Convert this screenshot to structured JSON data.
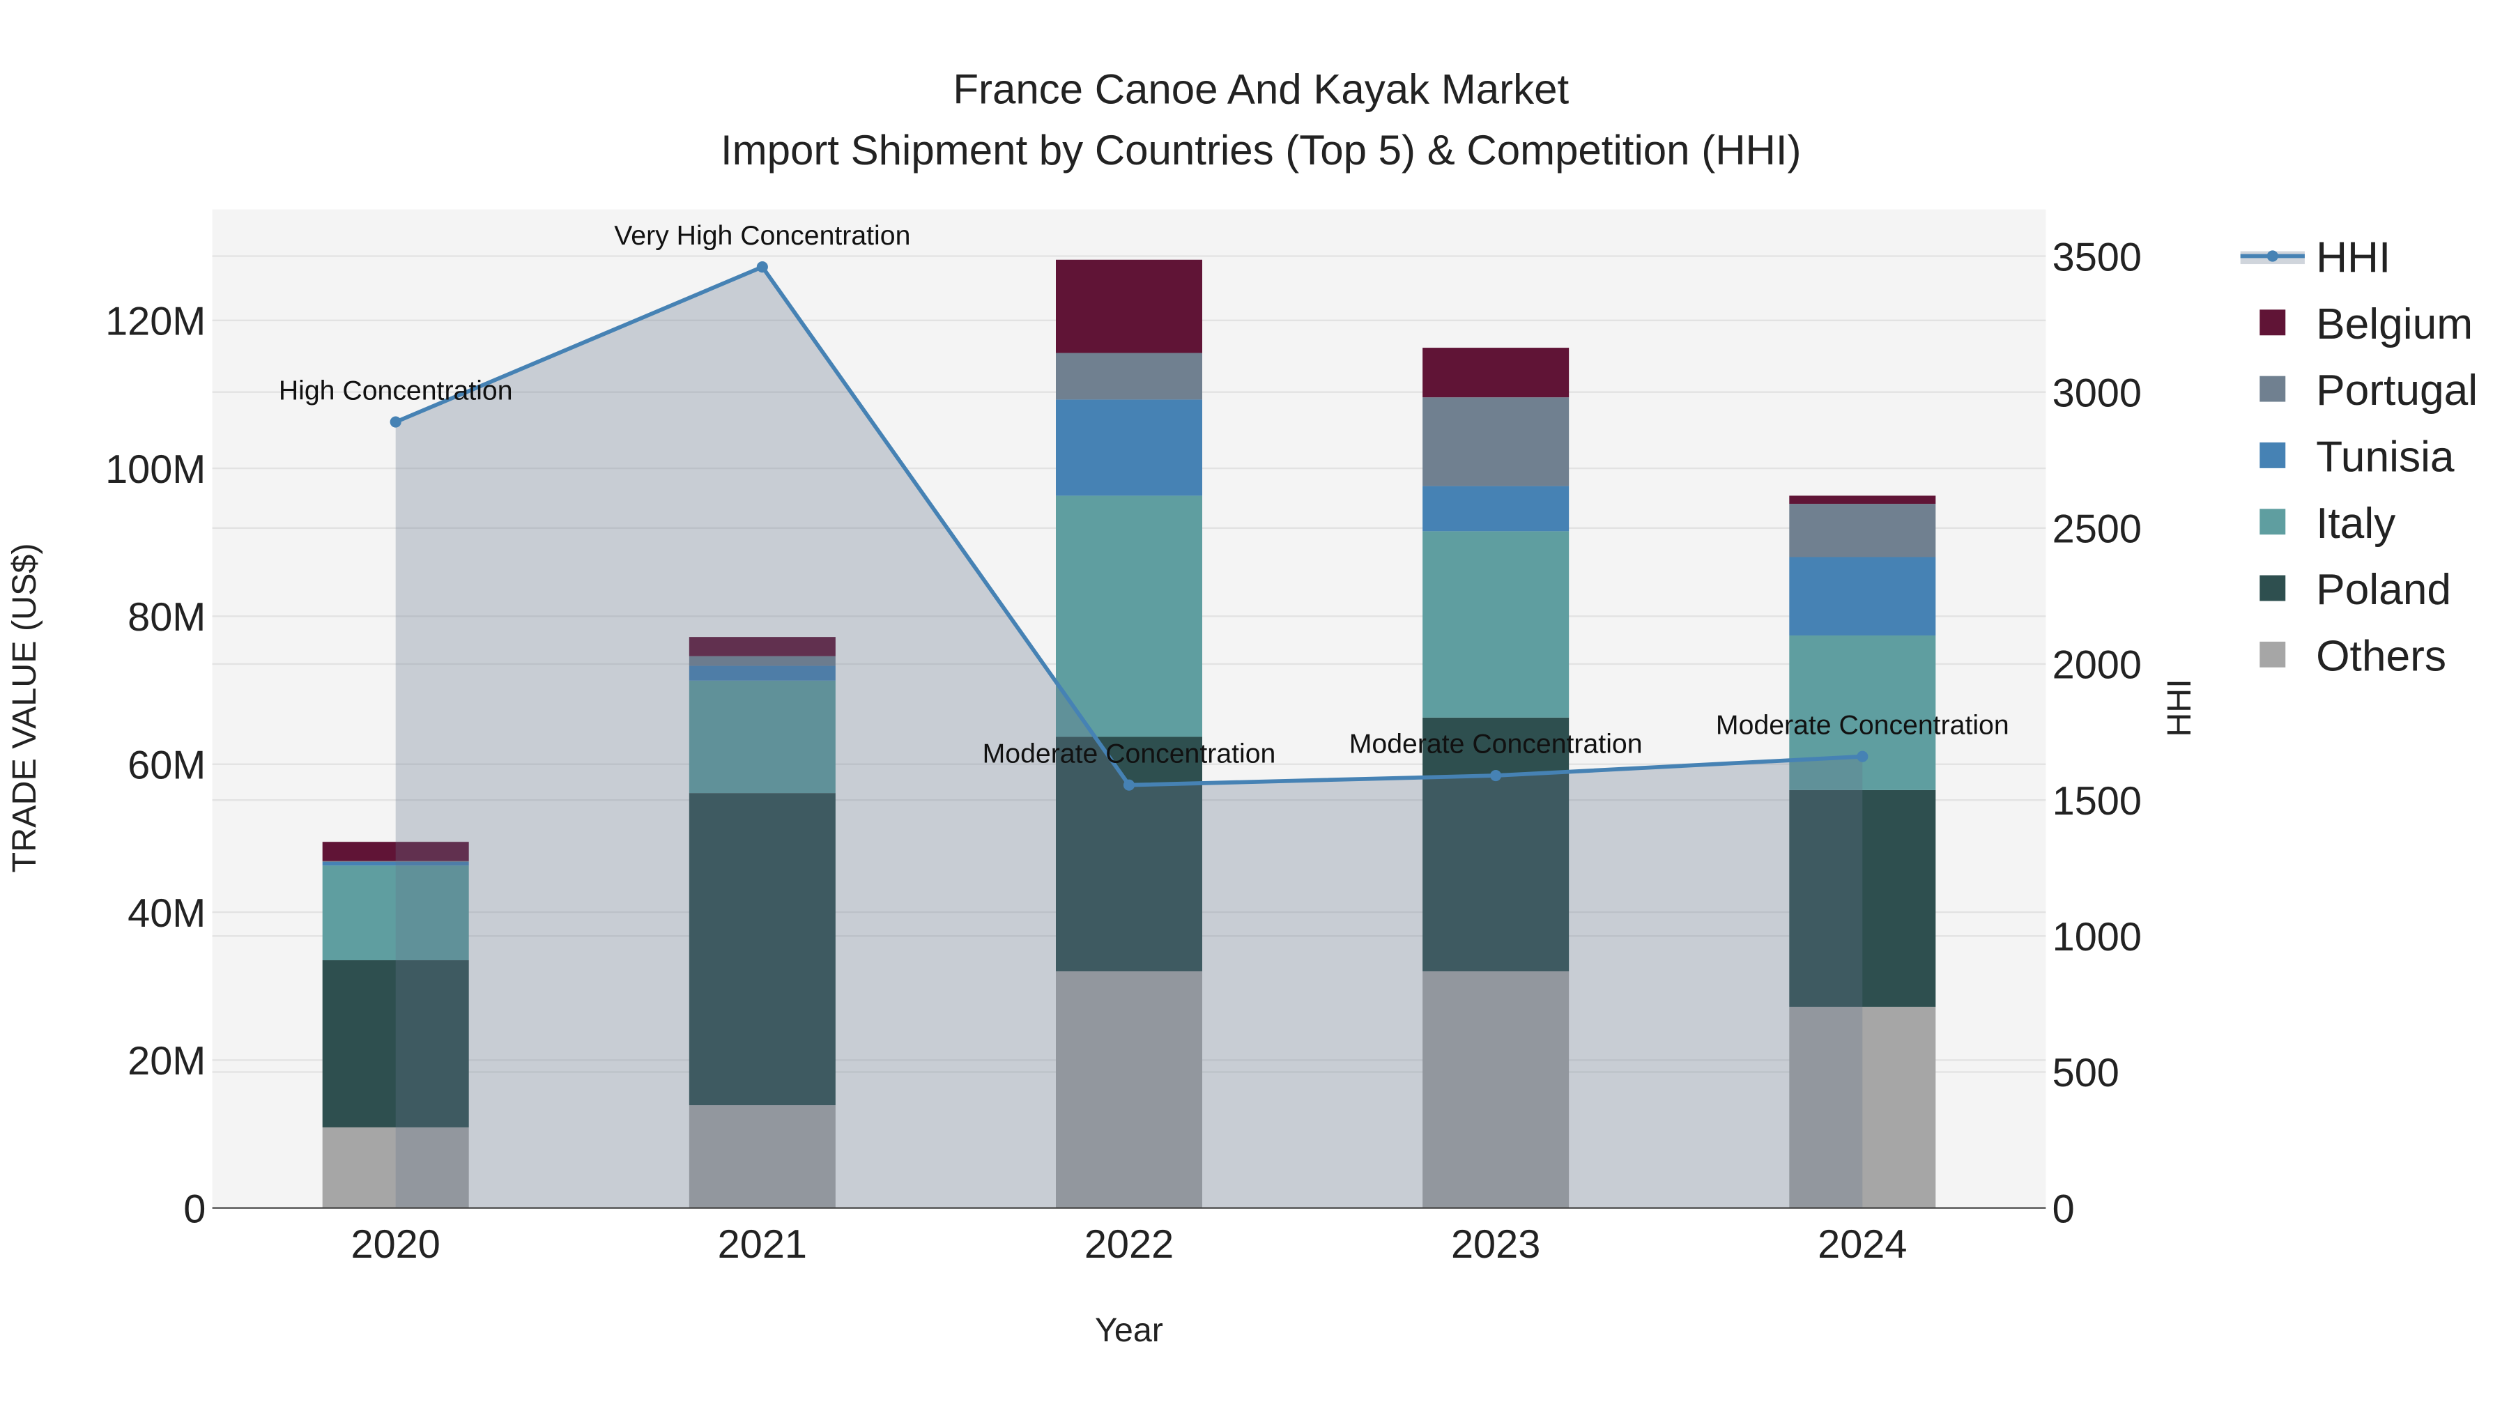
{
  "chart_data": {
    "type": "bar",
    "stacked": true,
    "title": "France Canoe And Kayak Market",
    "subtitle": "Import Shipment by Countries (Top 5) & Competition (HHI)",
    "xlabel": "Year",
    "ylabel": "TRADE VALUE (US$)",
    "y2label": "HHI",
    "categories": [
      "2020",
      "2021",
      "2022",
      "2023",
      "2024"
    ],
    "ylim": [
      0,
      135
    ],
    "y_unit": "M",
    "y_ticks": [
      0,
      20,
      40,
      60,
      80,
      100,
      120
    ],
    "y_tick_labels": [
      "0",
      "20M",
      "40M",
      "60M",
      "80M",
      "100M",
      "120M"
    ],
    "y2lim": [
      0,
      3675
    ],
    "y2_ticks": [
      0,
      500,
      1000,
      1500,
      2000,
      2500,
      3000,
      3500
    ],
    "y2_tick_labels": [
      "0",
      "500",
      "1000",
      "1500",
      "2000",
      "2500",
      "3000",
      "3500"
    ],
    "grid": true,
    "legend_position": "right",
    "series": [
      {
        "name": "Others",
        "color": "#a6a6a6",
        "values": [
          10.9,
          13.9,
          32.0,
          32.0,
          27.2
        ]
      },
      {
        "name": "Poland",
        "color": "#2e4f4f",
        "values": [
          22.6,
          42.2,
          31.7,
          34.3,
          29.3
        ]
      },
      {
        "name": "Italy",
        "color": "#5f9ea0",
        "values": [
          12.8,
          15.2,
          32.6,
          25.2,
          20.9
        ]
      },
      {
        "name": "Tunisia",
        "color": "#4682b4",
        "values": [
          0.5,
          2.0,
          13.0,
          6.1,
          10.6
        ]
      },
      {
        "name": "Portugal",
        "color": "#708090",
        "values": [
          0.1,
          1.3,
          6.3,
          12.0,
          7.2
        ]
      },
      {
        "name": "Belgium",
        "color": "#601436",
        "values": [
          2.6,
          2.6,
          12.6,
          6.7,
          1.1
        ]
      }
    ],
    "line": {
      "name": "HHI",
      "color": "#4682b4",
      "values": [
        2890,
        3460,
        1555,
        1590,
        1660
      ],
      "annotations": [
        "High Concentration",
        "Very High Concentration",
        "Moderate Concentration",
        "Moderate Concentration",
        "Moderate Concentration"
      ]
    },
    "legend_order": [
      "HHI",
      "Belgium",
      "Portugal",
      "Tunisia",
      "Italy",
      "Poland",
      "Others"
    ]
  }
}
